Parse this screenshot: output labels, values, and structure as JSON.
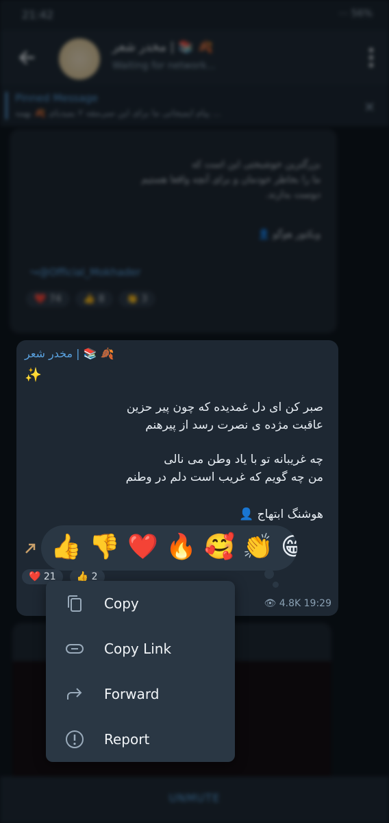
{
  "status_bar": {
    "time": "21:42",
    "indicators": "⋯ 56%"
  },
  "header": {
    "title": "مخدر شعر | 📚 🍂",
    "subtitle": "Waiting for network..."
  },
  "pinned": {
    "title": "Pinned Message",
    "text": "پیام ایمیجانی ما برای این سی‌مقه ۲ بمیدیای 🍂 بهمه ..."
  },
  "previous_post": {
    "lines": [
      "بزرگترین خوشبختی این است که",
      "ما را بخاطر خودمان و برای آنچه واقعا هستیم",
      "دوست بدارند.",
      "ویکتور هوگو 👤"
    ],
    "link": "↪@Official_Mokhader",
    "reactions": [
      "❤️ 74",
      "👍 8",
      "👏 3"
    ]
  },
  "message": {
    "sender": "مخدر شعر | 📚 🍂",
    "sparkle": "✨",
    "poem_lines": [
      "صبر کن ای دل غمدیده که چون پیر حزین",
      "عاقبت مژده ی نصرت رسد از پیرهنم",
      "چه غریبانه تو با یاد وطن می نالی",
      "من چه گویم که غریب است دلم در وطنم",
      "هوشنگ ابتهاج 👤"
    ],
    "reactions": [
      "❤️ 21",
      "👍 2"
    ],
    "views": "4.8K",
    "time": "19:29"
  },
  "reaction_picker": {
    "emojis": [
      "👍",
      "👎",
      "❤️",
      "🔥",
      "🥰",
      "👏",
      "😁"
    ]
  },
  "context_menu": {
    "copy": "Copy",
    "copy_link": "Copy Link",
    "forward": "Forward",
    "report": "Report"
  },
  "bottom_bar": {
    "label": "UNMUTE"
  },
  "colors": {
    "accent": "#5aa2e0",
    "bubble": "#1e2833",
    "menu": "#2a3744",
    "background": "#0f1720"
  }
}
